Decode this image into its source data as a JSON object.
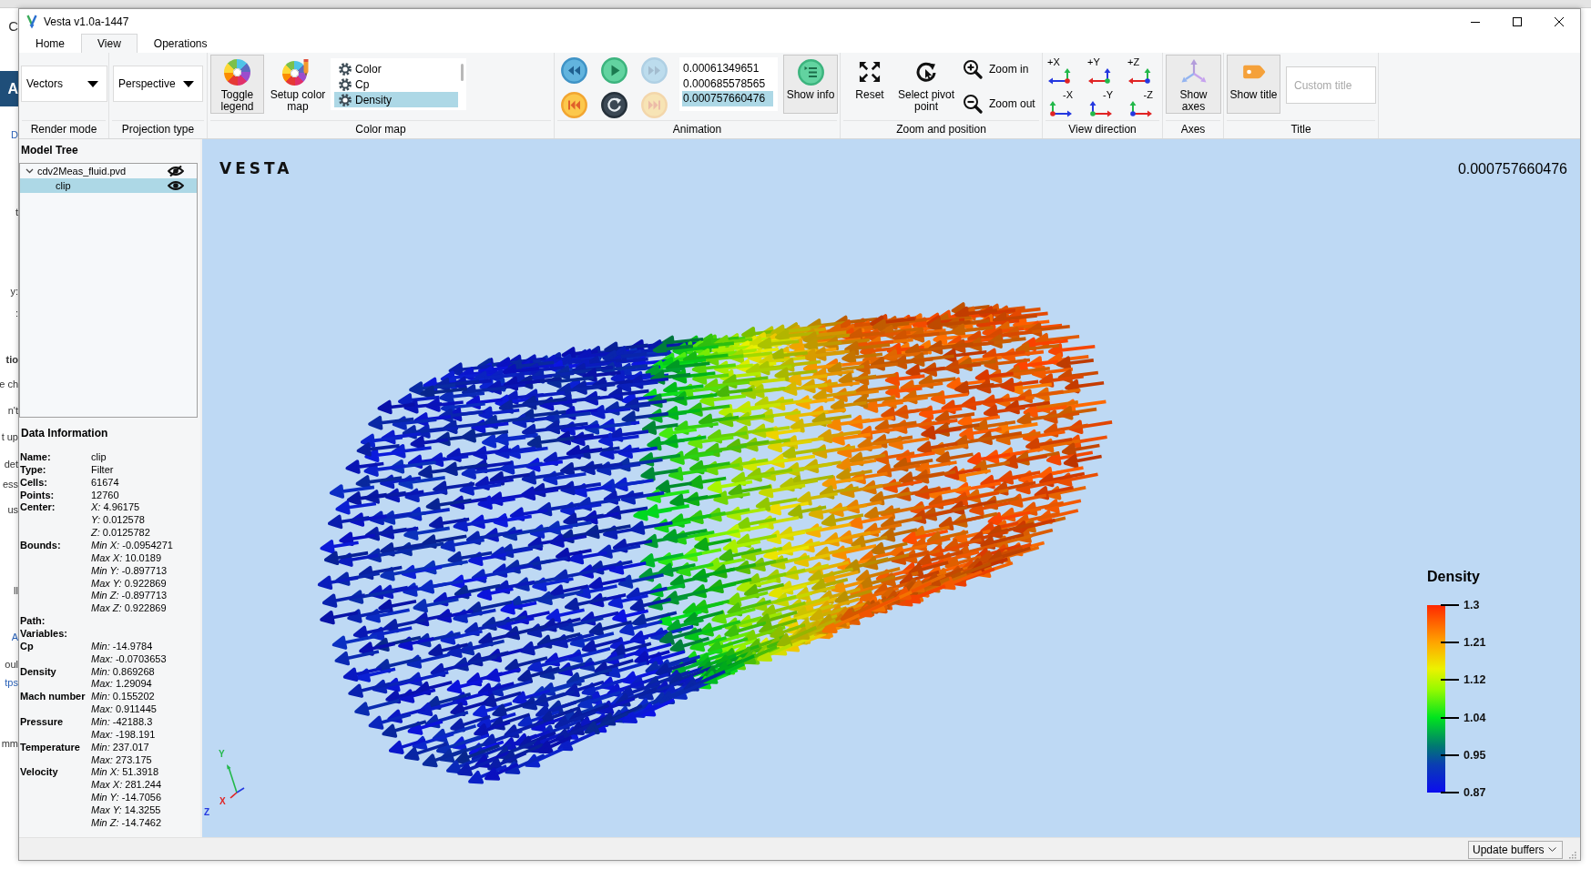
{
  "background": {
    "fragments": [
      {
        "text": "C",
        "kind": "plain"
      },
      {
        "text": "A",
        "kind": "banner"
      },
      {
        "text": "D",
        "kind": "link"
      },
      {
        "text": "t",
        "kind": "plain"
      },
      {
        "text": "y:",
        "kind": "plain"
      },
      {
        "text": ":",
        "kind": "plain"
      },
      {
        "text": "tio",
        "kind": "bold"
      },
      {
        "text": "e ch",
        "kind": "plain"
      },
      {
        "text": "n't",
        "kind": "plain"
      },
      {
        "text": "t up",
        "kind": "plain"
      },
      {
        "text": "det",
        "kind": "plain"
      },
      {
        "text": "ess",
        "kind": "plain"
      },
      {
        "text": "us",
        "kind": "plain"
      },
      {
        "text": "ll",
        "kind": "plain"
      },
      {
        "text": "A",
        "kind": "link"
      },
      {
        "text": "oul",
        "kind": "plain"
      },
      {
        "text": "tps",
        "kind": "link"
      },
      {
        "text": "mm",
        "kind": "plain"
      }
    ]
  },
  "window": {
    "title": "Vesta v1.0a-1447"
  },
  "tabs": [
    {
      "label": "Home",
      "selected": false
    },
    {
      "label": "View",
      "selected": true
    },
    {
      "label": "Operations",
      "selected": false
    }
  ],
  "ribbon": {
    "render_mode": {
      "value": "Vectors",
      "label": "Render mode"
    },
    "projection": {
      "value": "Perspective",
      "label": "Projection type"
    },
    "color_map": {
      "label": "Color map",
      "buttons": [
        {
          "label": "Toggle legend",
          "kind": "legend",
          "checked": true
        },
        {
          "label": "Setup color map",
          "kind": "setup",
          "checked": false
        }
      ],
      "variables": [
        {
          "name": "Color",
          "selected": false
        },
        {
          "name": "Cp",
          "selected": false
        },
        {
          "name": "Density",
          "selected": true
        }
      ]
    },
    "animation": {
      "label": "Animation",
      "controls": [
        {
          "kind": "back",
          "disabled": false
        },
        {
          "kind": "play",
          "disabled": false
        },
        {
          "kind": "forward",
          "disabled": true
        },
        {
          "kind": "first",
          "disabled": false
        },
        {
          "kind": "loop",
          "disabled": false
        },
        {
          "kind": "last",
          "disabled": true
        }
      ],
      "timesteps": [
        {
          "value": "0.00061349651",
          "selected": false
        },
        {
          "value": "0.000685578565",
          "selected": false
        },
        {
          "value": "0.000757660476",
          "selected": true
        }
      ],
      "info_button": {
        "label": "Show info",
        "checked": true
      }
    },
    "zoom": {
      "label": "Zoom and position",
      "buttons": [
        {
          "label": "Reset",
          "kind": "reset"
        },
        {
          "label": "Select pivot point",
          "kind": "pivot"
        },
        {
          "label": "Zoom in",
          "kind": "zoom_in"
        },
        {
          "label": "Zoom out",
          "kind": "zoom_out"
        }
      ]
    },
    "view_direction": {
      "label": "View direction",
      "buttons": [
        {
          "label": "+X",
          "kind": "x",
          "negative": false
        },
        {
          "label": "+Y",
          "kind": "y",
          "negative": false
        },
        {
          "label": "+Z",
          "kind": "z",
          "negative": false
        },
        {
          "label": "-X",
          "kind": "x",
          "negative": true
        },
        {
          "label": "-Y",
          "kind": "y",
          "negative": true
        },
        {
          "label": "-Z",
          "kind": "z",
          "negative": true
        }
      ]
    },
    "axes": {
      "label": "Axes",
      "button": {
        "label": "Show axes",
        "checked": true
      }
    },
    "title": {
      "label": "Title",
      "button": {
        "label": "Show title",
        "checked": true
      },
      "input": {
        "placeholder": "Custom title"
      }
    }
  },
  "model_tree": {
    "title": "Model Tree",
    "items": [
      {
        "name": "cdv2Meas_fluid.pvd",
        "expanded": true,
        "visible": false,
        "selected": false,
        "children": [
          {
            "name": "clip",
            "visible": true,
            "selected": true
          }
        ]
      }
    ]
  },
  "data_information": {
    "title": "Data Information",
    "rows": [
      {
        "label": "Name:",
        "values": [
          "clip"
        ]
      },
      {
        "label": "Type:",
        "values": [
          "Filter"
        ]
      },
      {
        "label": "Cells:",
        "values": [
          "61674"
        ]
      },
      {
        "label": "Points:",
        "values": [
          "12760"
        ]
      },
      {
        "label": "Center:",
        "values": [
          "*X:* 4.96175",
          "*Y:* 0.012578",
          "*Z:* 0.0125782"
        ]
      },
      {
        "label": "Bounds:",
        "values": [
          "*Min X:* -0.0954271",
          "*Max X:* 10.0189",
          "*Min Y:* -0.897713",
          "*Max Y:* 0.922869",
          "*Min Z:* -0.897713",
          "*Max Z:* 0.922869"
        ]
      },
      {
        "label": "Path:"
      },
      {
        "label": "Variables:"
      },
      {
        "label": "Cp",
        "values": [
          "*Min:* -14.9784",
          "*Max:* -0.0703653"
        ]
      },
      {
        "label": "Density",
        "values": [
          "*Min:* 0.869268",
          "*Max:* 1.29094"
        ]
      },
      {
        "label": "Mach number",
        "values": [
          "*Min:* 0.155202",
          "*Max:* 0.911445"
        ]
      },
      {
        "label": "Pressure",
        "values": [
          "*Min:* -42188.3",
          "*Max:* -198.191"
        ]
      },
      {
        "label": "Temperature",
        "values": [
          "*Min:* 237.017",
          "*Max:* 273.175"
        ]
      },
      {
        "label": "Velocity",
        "values": [
          "*Min X:* 51.3918",
          "*Max X:* 281.244",
          "*Min Y:* -14.7056",
          "*Max Y:* 14.3255",
          "*Min Z:* -14.7462"
        ]
      }
    ]
  },
  "viewport": {
    "logo": "VESTA",
    "time": "0.000757660476",
    "legend": {
      "title": "Density",
      "ticks": [
        "1.3",
        "1.21",
        "1.12",
        "1.04",
        "0.95",
        "0.87"
      ]
    },
    "axes_triad": [
      {
        "label": "Y",
        "color": "#22b84a"
      },
      {
        "label": "X",
        "color": "#e02424"
      },
      {
        "label": "Z",
        "color": "#2438e0"
      }
    ]
  },
  "status_bar": {
    "dropdown": "Update buffers"
  }
}
